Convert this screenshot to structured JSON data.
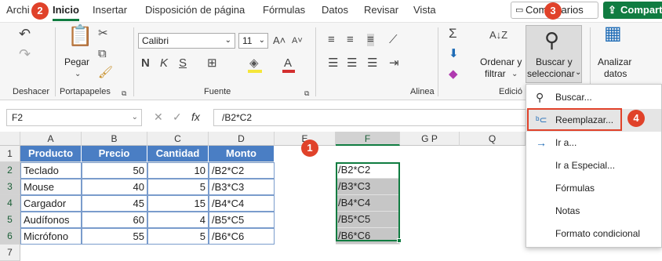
{
  "tabs": [
    {
      "label": "Archi",
      "active": false
    },
    {
      "label": "Inicio",
      "active": true
    },
    {
      "label": "Insertar",
      "active": false
    },
    {
      "label": "Disposición de página",
      "active": false
    },
    {
      "label": "Fórmulas",
      "active": false
    },
    {
      "label": "Datos",
      "active": false
    },
    {
      "label": "Revisar",
      "active": false
    },
    {
      "label": "Vista",
      "active": false
    }
  ],
  "comments_label": "Comentarios",
  "share_label": "Compartir",
  "badges": [
    "1",
    "2",
    "3",
    "4"
  ],
  "ribbon": {
    "undo_group": "Deshacer",
    "paste_label": "Pegar",
    "clipboard_group": "Portapapeles",
    "font_name": "Calibri",
    "font_size": "11",
    "bold": "N",
    "italic": "K",
    "underline": "S",
    "font_group": "Fuente",
    "align_group": "Alinea",
    "sort_label_1": "Ordenar y",
    "sort_label_2": "filtrar",
    "edit_group": "Edició",
    "find_label_1": "Buscar y",
    "find_label_2": "seleccionar",
    "analyze_label_1": "Analizar",
    "analyze_label_2": "datos"
  },
  "namebox": "F2",
  "fx_label": "fx",
  "formula": "/B2*C2",
  "columns": [
    "A",
    "B",
    "C",
    "D",
    "E",
    "F",
    "G",
    "P",
    "Q"
  ],
  "rows": [
    "1",
    "2",
    "3",
    "4",
    "5",
    "6",
    "7"
  ],
  "table": {
    "headers": [
      "Producto",
      "Precio",
      "Cantidad",
      "Monto"
    ],
    "rows": [
      [
        "Teclado",
        "50",
        "10",
        "/B2*C2"
      ],
      [
        "Mouse",
        "40",
        "5",
        "/B3*C3"
      ],
      [
        "Cargador",
        "45",
        "15",
        "/B4*C4"
      ],
      [
        "Audífonos",
        "60",
        "4",
        "/B5*C5"
      ],
      [
        "Micrófono",
        "55",
        "5",
        "/B6*C6"
      ]
    ]
  },
  "col_f": [
    "/B2*C2",
    "/B3*C3",
    "/B4*C4",
    "/B5*C5",
    "/B6*C6"
  ],
  "menu": [
    {
      "label": "Buscar...",
      "icon": "search-icon"
    },
    {
      "label": "Reemplazar...",
      "icon": "replace-icon"
    },
    {
      "label": "Ir a...",
      "icon": "arrow-right-icon"
    },
    {
      "label": "Ir a Especial...",
      "icon": ""
    },
    {
      "label": "Fórmulas",
      "icon": ""
    },
    {
      "label": "Notas",
      "icon": ""
    },
    {
      "label": "Formato condicional",
      "icon": ""
    }
  ],
  "colors": {
    "accent": "#107c41",
    "header_fill": "#4a7ec4",
    "badge": "#e0422a"
  }
}
